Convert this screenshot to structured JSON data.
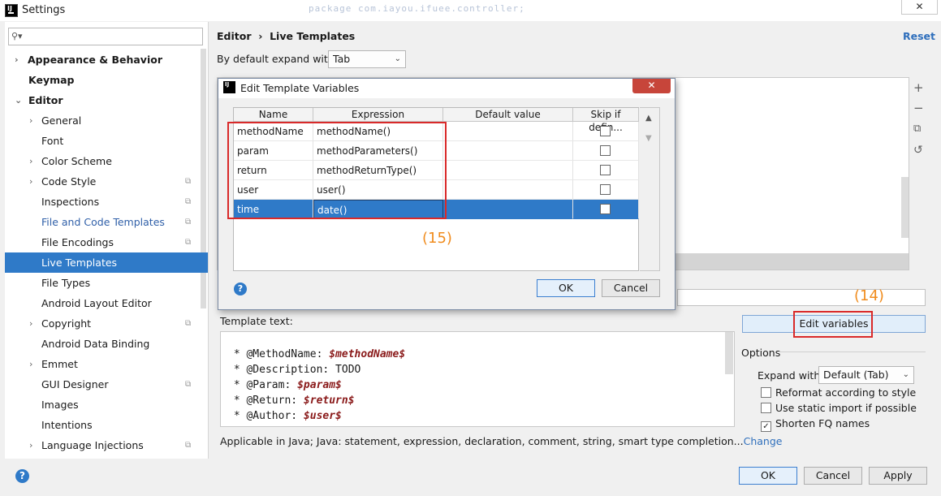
{
  "window": {
    "title": "Settings",
    "close": "✕",
    "faded_code": "package com.iayou.ifuee.controller;"
  },
  "search": {
    "placeholder": ""
  },
  "sidebar": {
    "items": [
      {
        "label": "Appearance & Behavior"
      },
      {
        "label": "Keymap"
      },
      {
        "label": "Editor"
      },
      {
        "label": "General"
      },
      {
        "label": "Font"
      },
      {
        "label": "Color Scheme"
      },
      {
        "label": "Code Style"
      },
      {
        "label": "Inspections"
      },
      {
        "label": "File and Code Templates"
      },
      {
        "label": "File Encodings"
      },
      {
        "label": "Live Templates"
      },
      {
        "label": "File Types"
      },
      {
        "label": "Android Layout Editor"
      },
      {
        "label": "Copyright"
      },
      {
        "label": "Android Data Binding"
      },
      {
        "label": "Emmet"
      },
      {
        "label": "GUI Designer"
      },
      {
        "label": "Images"
      },
      {
        "label": "Intentions"
      },
      {
        "label": "Language Injections"
      }
    ]
  },
  "breadcrumb": {
    "parent": "Editor",
    "separator": "›",
    "current": "Live Templates"
  },
  "reset_label": "Reset",
  "expand_default": {
    "label": "By default expand with",
    "value": "Tab"
  },
  "annotations": {
    "label_14": "(14)",
    "label_15": "(15)"
  },
  "edit_variables_label": "Edit variables",
  "template_text": {
    "label": "Template text:",
    "lines": [
      {
        "prefix": " * @MethodName: ",
        "var": "$methodName$"
      },
      {
        "prefix": " * @Description: TODO",
        "var": ""
      },
      {
        "prefix": " * @Param: ",
        "var": "$param$"
      },
      {
        "prefix": " * @Return: ",
        "var": "$return$"
      },
      {
        "prefix": " * @Author: ",
        "var": "$user$"
      }
    ]
  },
  "options": {
    "label": "Options",
    "expand_with_label": "Expand with",
    "expand_with_value": "Default (Tab)",
    "checkboxes": [
      {
        "label": "Reformat according to style",
        "checked": false
      },
      {
        "label": "Use static import if possible",
        "checked": false
      },
      {
        "label": "Shorten FQ names",
        "checked": true
      }
    ]
  },
  "applicable": {
    "text": "Applicable in Java; Java: statement, expression, declaration, comment, string, smart type completion...",
    "change": "Change"
  },
  "footer": {
    "ok": "OK",
    "cancel": "Cancel",
    "apply": "Apply",
    "help": "?"
  },
  "dialog": {
    "title": "Edit Template Variables",
    "close": "✕",
    "columns": [
      "Name",
      "Expression",
      "Default value",
      "Skip if defin..."
    ],
    "rows": [
      {
        "name": "methodName",
        "expression": "methodName()",
        "default": "",
        "skip": false
      },
      {
        "name": "param",
        "expression": "methodParameters()",
        "default": "",
        "skip": false
      },
      {
        "name": "return",
        "expression": "methodReturnType()",
        "default": "",
        "skip": false
      },
      {
        "name": "user",
        "expression": "user()",
        "default": "",
        "skip": false
      },
      {
        "name": "time",
        "expression": "date()",
        "default": "",
        "skip": false
      }
    ],
    "ok": "OK",
    "cancel": "Cancel",
    "help": "?"
  }
}
